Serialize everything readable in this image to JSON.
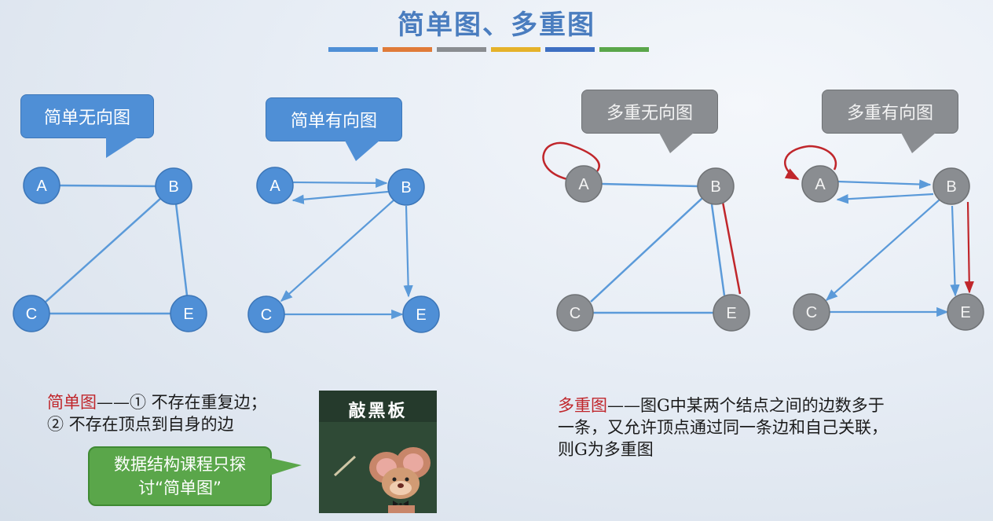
{
  "slide": {
    "title": "简单图、多重图",
    "title_bar_colors": [
      "#4f8fd6",
      "#e07b39",
      "#8a8d91",
      "#e5b22a",
      "#3d6fc2",
      "#5aa64a"
    ]
  },
  "graphs": {
    "simple_undirected": {
      "label": "简单无向图",
      "nodes": [
        "A",
        "B",
        "C",
        "E"
      ],
      "edges": [
        [
          "A",
          "B"
        ],
        [
          "B",
          "C"
        ],
        [
          "B",
          "E"
        ],
        [
          "C",
          "E"
        ]
      ]
    },
    "simple_directed": {
      "label": "简单有向图",
      "nodes": [
        "A",
        "B",
        "C",
        "E"
      ],
      "arcs": [
        [
          "A",
          "B"
        ],
        [
          "B",
          "A"
        ],
        [
          "B",
          "C"
        ],
        [
          "B",
          "E"
        ],
        [
          "C",
          "E"
        ]
      ]
    },
    "multi_undirected": {
      "label": "多重无向图",
      "nodes": [
        "A",
        "B",
        "C",
        "E"
      ],
      "edges": [
        [
          "A",
          "A"
        ],
        [
          "A",
          "B"
        ],
        [
          "B",
          "C"
        ],
        [
          "B",
          "E"
        ],
        [
          "B",
          "E"
        ],
        [
          "C",
          "E"
        ]
      ]
    },
    "multi_directed": {
      "label": "多重有向图",
      "nodes": [
        "A",
        "B",
        "C",
        "E"
      ],
      "arcs": [
        [
          "A",
          "A"
        ],
        [
          "A",
          "B"
        ],
        [
          "B",
          "A"
        ],
        [
          "B",
          "C"
        ],
        [
          "B",
          "E"
        ],
        [
          "B",
          "E"
        ],
        [
          "C",
          "E"
        ]
      ]
    }
  },
  "simple_def": {
    "key": "简单图",
    "line1_rest": "——① 不存在重复边；",
    "line2": "② 不存在顶点到自身的边"
  },
  "green_note": {
    "line1": "数据结构课程只探",
    "line2": "讨“简单图”"
  },
  "meme": {
    "caption": "敲黑板"
  },
  "multi_def": {
    "key": "多重图",
    "line1_rest": "——图G中某两个结点之间的边数多于",
    "line2": "一条，又允许顶点通过同一条边和自己关联，",
    "line3": "则G为多重图"
  },
  "colors": {
    "node_blue": "#4f8fd6",
    "node_gray": "#8a8d91",
    "edge_blue": "#5b9ad9",
    "loop_red": "#c0262b"
  }
}
